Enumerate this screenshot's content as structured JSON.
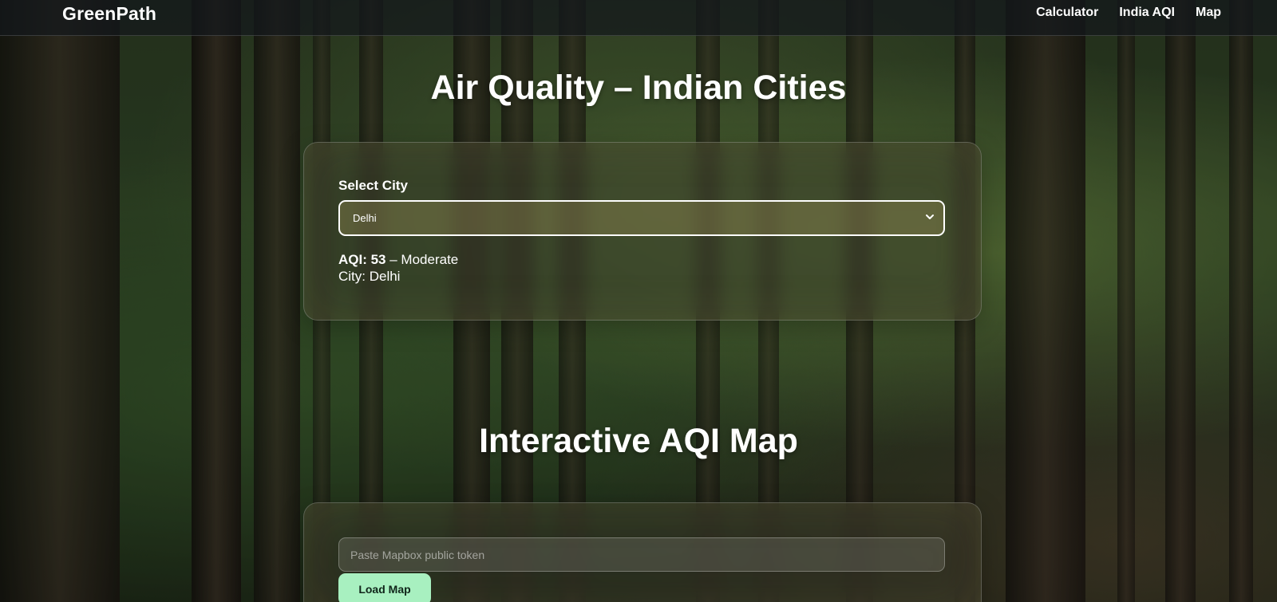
{
  "brand": {
    "name": "GreenPath"
  },
  "nav": {
    "items": [
      {
        "label": "Calculator"
      },
      {
        "label": "India AQI"
      },
      {
        "label": "Map"
      }
    ]
  },
  "aqi_section": {
    "title": "Air Quality – Indian Cities",
    "select_label": "Select City",
    "selected_city": "Delhi",
    "aqi_label": "AQI: 53",
    "aqi_status": " – Moderate",
    "city_line": "City: Delhi"
  },
  "map_section": {
    "title": "Interactive AQI Map",
    "token_placeholder": "Paste Mapbox public token",
    "token_value": "",
    "load_button_label": "Load Map"
  },
  "colors": {
    "accent_button": "#a8f0c0",
    "navbar_bg": "#14181c"
  },
  "icons": {
    "select_chevron": "chevron-down-icon"
  }
}
